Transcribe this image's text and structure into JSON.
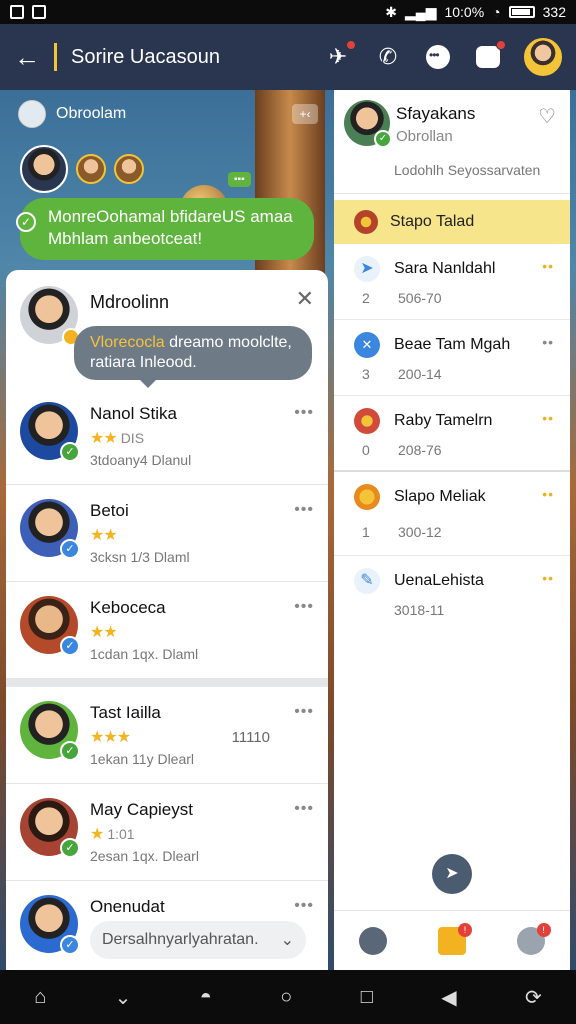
{
  "status_bar": {
    "time": "10:0%",
    "right_text": "332"
  },
  "header": {
    "title": "Sorire Uacasoun"
  },
  "group": {
    "label": "Obroolam",
    "badge": ""
  },
  "green_message": {
    "line1": "MonreOohamal bfidareUS amaa",
    "line2": "Mbhlam anbeotceat!"
  },
  "left_panel": {
    "name": "Mdroolinn",
    "tooltip": {
      "highlight": "Vlorecocla",
      "text": " dreamo moolclte, ratiara Inleood."
    },
    "friends": [
      {
        "name": "Nanol Stika",
        "stars": "★★",
        "tag": "DIS",
        "meta": "3tdoany4 Dlanul",
        "check": "green"
      },
      {
        "name": "Betoi",
        "stars": "★★",
        "tag": "",
        "meta": "3cksn 1/3 Dlaml",
        "check": "blue"
      },
      {
        "name": "Keboceca",
        "stars": "★★",
        "tag": "",
        "meta": "1cdan 1qx. Dlaml",
        "check": "blue"
      },
      {
        "name": "Tast Iailla",
        "stars": "★★★",
        "tag": "",
        "meta": "1ekan 11y Dlearl",
        "extra": "11110",
        "check": "green"
      },
      {
        "name": "May Capieyst",
        "stars": "★",
        "tag": "1:01",
        "meta": "2esan 1qx. Dlearl",
        "check": "green"
      },
      {
        "name": "Onenudat",
        "reply": "Dersalhnyarlyahratan.",
        "check": "blue"
      }
    ]
  },
  "right_panel": {
    "name": "Sfayakans",
    "sub": "Obrollan",
    "desc": "Lodohlh Seyossarvaten",
    "highlight": "Stapo Talad",
    "items": [
      {
        "name": "Sara Nanldahl",
        "num": "2",
        "sub": "506-70",
        "more": "yellow"
      },
      {
        "name": "Beae Tam Mgah",
        "num": "3",
        "sub": "200-14",
        "more": "gray"
      },
      {
        "name": "Raby Tamelrn",
        "num": "0",
        "sub": "208-76",
        "more": "yellow"
      },
      {
        "name": "Slapo Meliak",
        "num": "1",
        "sub": "300-12",
        "more": "yellow"
      },
      {
        "name": "UenaLehista",
        "num": "",
        "sub": "3018-11",
        "more": "yellow"
      }
    ]
  },
  "colors": {
    "accent": "#f3c338",
    "green": "#5fb43d",
    "header": "#2a3550",
    "highlight": "#f6e58a"
  }
}
